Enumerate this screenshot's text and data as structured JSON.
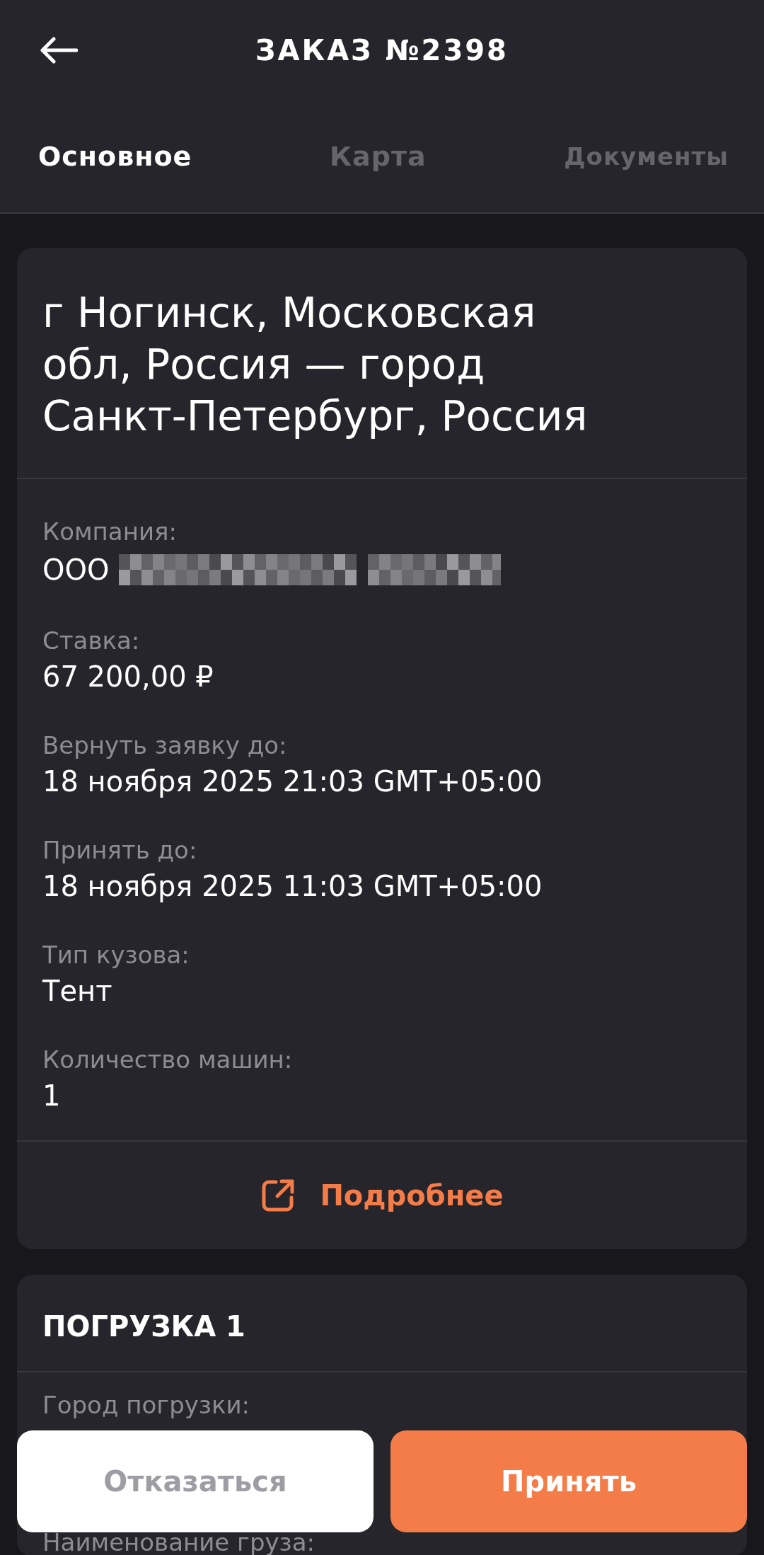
{
  "header": {
    "title": "ЗАКАЗ №2398"
  },
  "tabs": [
    {
      "label": "Основное",
      "selected": true
    },
    {
      "label": "Карта",
      "selected": false
    },
    {
      "label": "Документы",
      "selected": false
    }
  ],
  "summary_card": {
    "route": "г Ногинск, Московская обл, Россия — город Санкт-Петербург, Россия",
    "fields": [
      {
        "label": "Компания:",
        "value": "ООО",
        "redacted": true
      },
      {
        "label": "Ставка:",
        "value": "67 200,00 ₽",
        "redacted": false
      },
      {
        "label": "Вернуть заявку до:",
        "value": "18 ноября 2025 21:03 GMT+05:00",
        "redacted": false
      },
      {
        "label": "Принять до:",
        "value": "18 ноября 2025 11:03 GMT+05:00",
        "redacted": false
      },
      {
        "label": "Тип кузова:",
        "value": "Тент",
        "redacted": false
      },
      {
        "label": "Количество машин:",
        "value": "1",
        "redacted": false
      }
    ],
    "more_link": "Подробнее"
  },
  "loading_card": {
    "title": "ПОГРУЗКА 1",
    "labels": [
      "Город погрузки:",
      "Наименование груза:"
    ]
  },
  "actions": [
    {
      "label": "Отказаться",
      "kind": "secondary"
    },
    {
      "label": "Принять",
      "kind": "primary"
    }
  ]
}
